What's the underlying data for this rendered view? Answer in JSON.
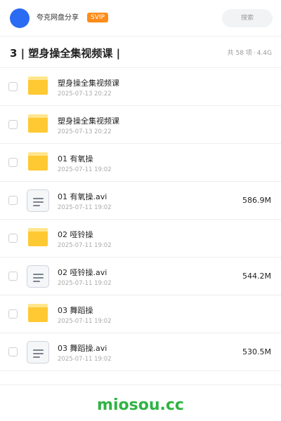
{
  "header": {
    "user_name": "夸克网盘分享",
    "badge": "SVIP",
    "search_placeholder": "搜索",
    "accent_color": "#2b6bf3"
  },
  "folder": {
    "title": "3 | 塑身操全集视频课 |",
    "count": "共 58 项",
    "separator": "·",
    "size": "4.4G"
  },
  "files": [
    {
      "type": "folder",
      "icon": "folder-icon",
      "name": "塑身操全集视频课",
      "date": "2025-07-13 20:22",
      "size": ""
    },
    {
      "type": "folder",
      "icon": "folder-icon",
      "name": "塑身操全集视频课",
      "date": "2025-07-13 20:22",
      "size": ""
    },
    {
      "type": "folder",
      "icon": "folder-icon",
      "name": "01 有氧操",
      "date": "2025-07-11 19:02",
      "size": ""
    },
    {
      "type": "video",
      "icon": "video-file-icon",
      "name": "01 有氧操.avi",
      "date": "2025-07-11 19:02",
      "size": "586.9M"
    },
    {
      "type": "folder",
      "icon": "folder-icon",
      "name": "02 哑铃操",
      "date": "2025-07-11 19:02",
      "size": ""
    },
    {
      "type": "video",
      "icon": "video-file-icon",
      "name": "02 哑铃操.avi",
      "date": "2025-07-11 19:02",
      "size": "544.2M"
    },
    {
      "type": "folder",
      "icon": "folder-icon",
      "name": "03 舞蹈操",
      "date": "2025-07-11 19:02",
      "size": ""
    },
    {
      "type": "video",
      "icon": "video-file-icon",
      "name": "03 舞蹈操.avi",
      "date": "2025-07-11 19:02",
      "size": "530.5M"
    }
  ],
  "footer": {
    "brand": "miosou.cc",
    "brand_color": "#2fb344"
  }
}
